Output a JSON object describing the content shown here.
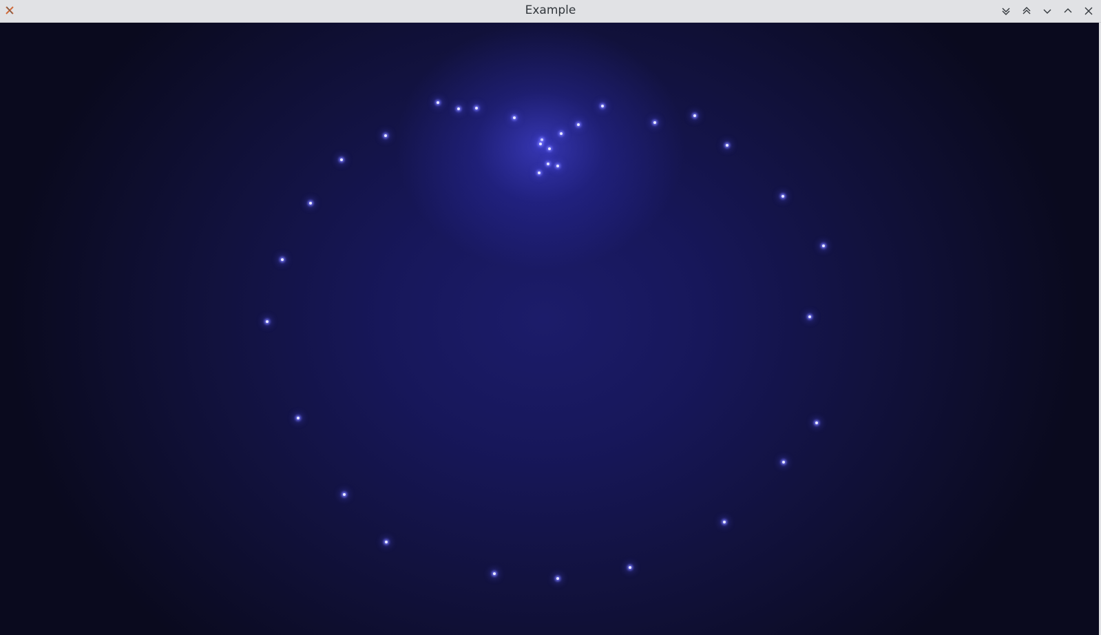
{
  "window": {
    "title": "Example",
    "app_icon": "x-app-icon",
    "controls": [
      {
        "name": "keep-below-button",
        "icon": "double-chevron-down-icon"
      },
      {
        "name": "keep-above-button",
        "icon": "double-chevron-up-icon"
      },
      {
        "name": "minimize-button",
        "icon": "chevron-down-icon"
      },
      {
        "name": "maximize-button",
        "icon": "chevron-up-icon"
      },
      {
        "name": "close-button",
        "icon": "close-icon"
      }
    ]
  },
  "colors": {
    "titlebar": "#e1e2e5",
    "background_dark": "#0a0a1e",
    "glow": "#5050ff",
    "particle": "#e8e8ff"
  }
}
